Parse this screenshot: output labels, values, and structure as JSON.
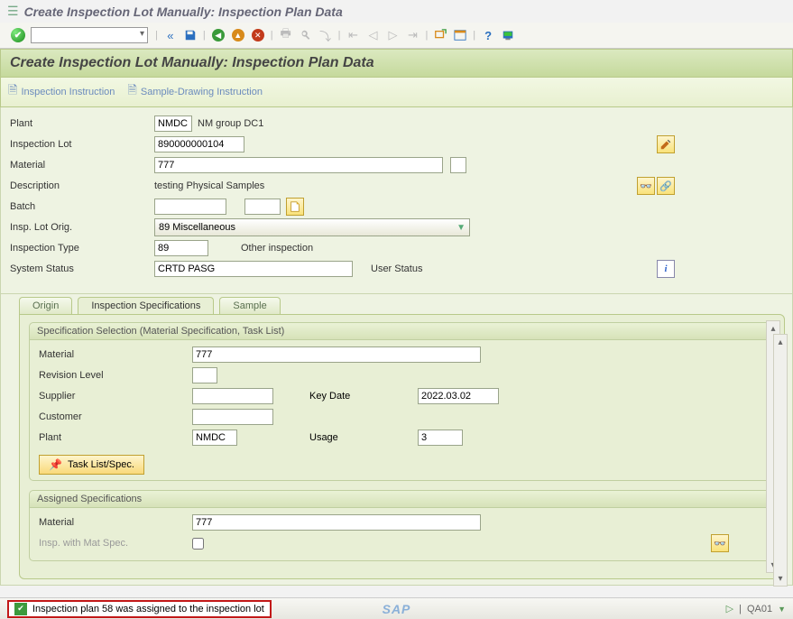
{
  "window": {
    "title": "Create Inspection Lot Manually: Inspection Plan Data"
  },
  "page": {
    "title": "Create Inspection Lot Manually: Inspection Plan Data"
  },
  "subtoolbar": {
    "inspection_instruction": "Inspection Instruction",
    "sample_drawing_instruction": "Sample-Drawing Instruction"
  },
  "header": {
    "plant_label": "Plant",
    "plant_value": "NMDC",
    "plant_desc": "NM group DC1",
    "lot_label": "Inspection Lot",
    "lot_value": "890000000104",
    "material_label": "Material",
    "material_value": "777",
    "description_label": "Description",
    "description_value": "testing Physical Samples",
    "batch_label": "Batch",
    "batch_value": "",
    "batch_value2": "",
    "orig_label": "Insp. Lot Orig.",
    "orig_value": "89 Miscellaneous",
    "type_label": "Inspection Type",
    "type_value": "89",
    "type_desc": "Other inspection",
    "sysstatus_label": "System Status",
    "sysstatus_value": "CRTD PASG",
    "userstatus_label": "User Status",
    "userstatus_value": ""
  },
  "tabs": {
    "items": [
      {
        "label": "Origin"
      },
      {
        "label": "Inspection Specifications"
      },
      {
        "label": "Sample"
      }
    ],
    "active_index": 1
  },
  "spec_selection": {
    "title": "Specification Selection (Material Specification, Task List)",
    "material_label": "Material",
    "material_value": "777",
    "revision_label": "Revision Level",
    "revision_value": "",
    "supplier_label": "Supplier",
    "supplier_value": "",
    "keydate_label": "Key Date",
    "keydate_value": "2022.03.02",
    "customer_label": "Customer",
    "customer_value": "",
    "plant_label": "Plant",
    "plant_value": "NMDC",
    "usage_label": "Usage",
    "usage_value": "3",
    "task_list_button": "Task List/Spec."
  },
  "assigned_spec": {
    "title": "Assigned Specifications",
    "material_label": "Material",
    "material_value": "777",
    "insp_mat_label": "Insp. with Mat Spec.",
    "insp_mat_checked": false
  },
  "statusbar": {
    "message": "Inspection plan 58 was assigned to the inspection lot",
    "sap": "SAP",
    "tcode": "QA01"
  }
}
